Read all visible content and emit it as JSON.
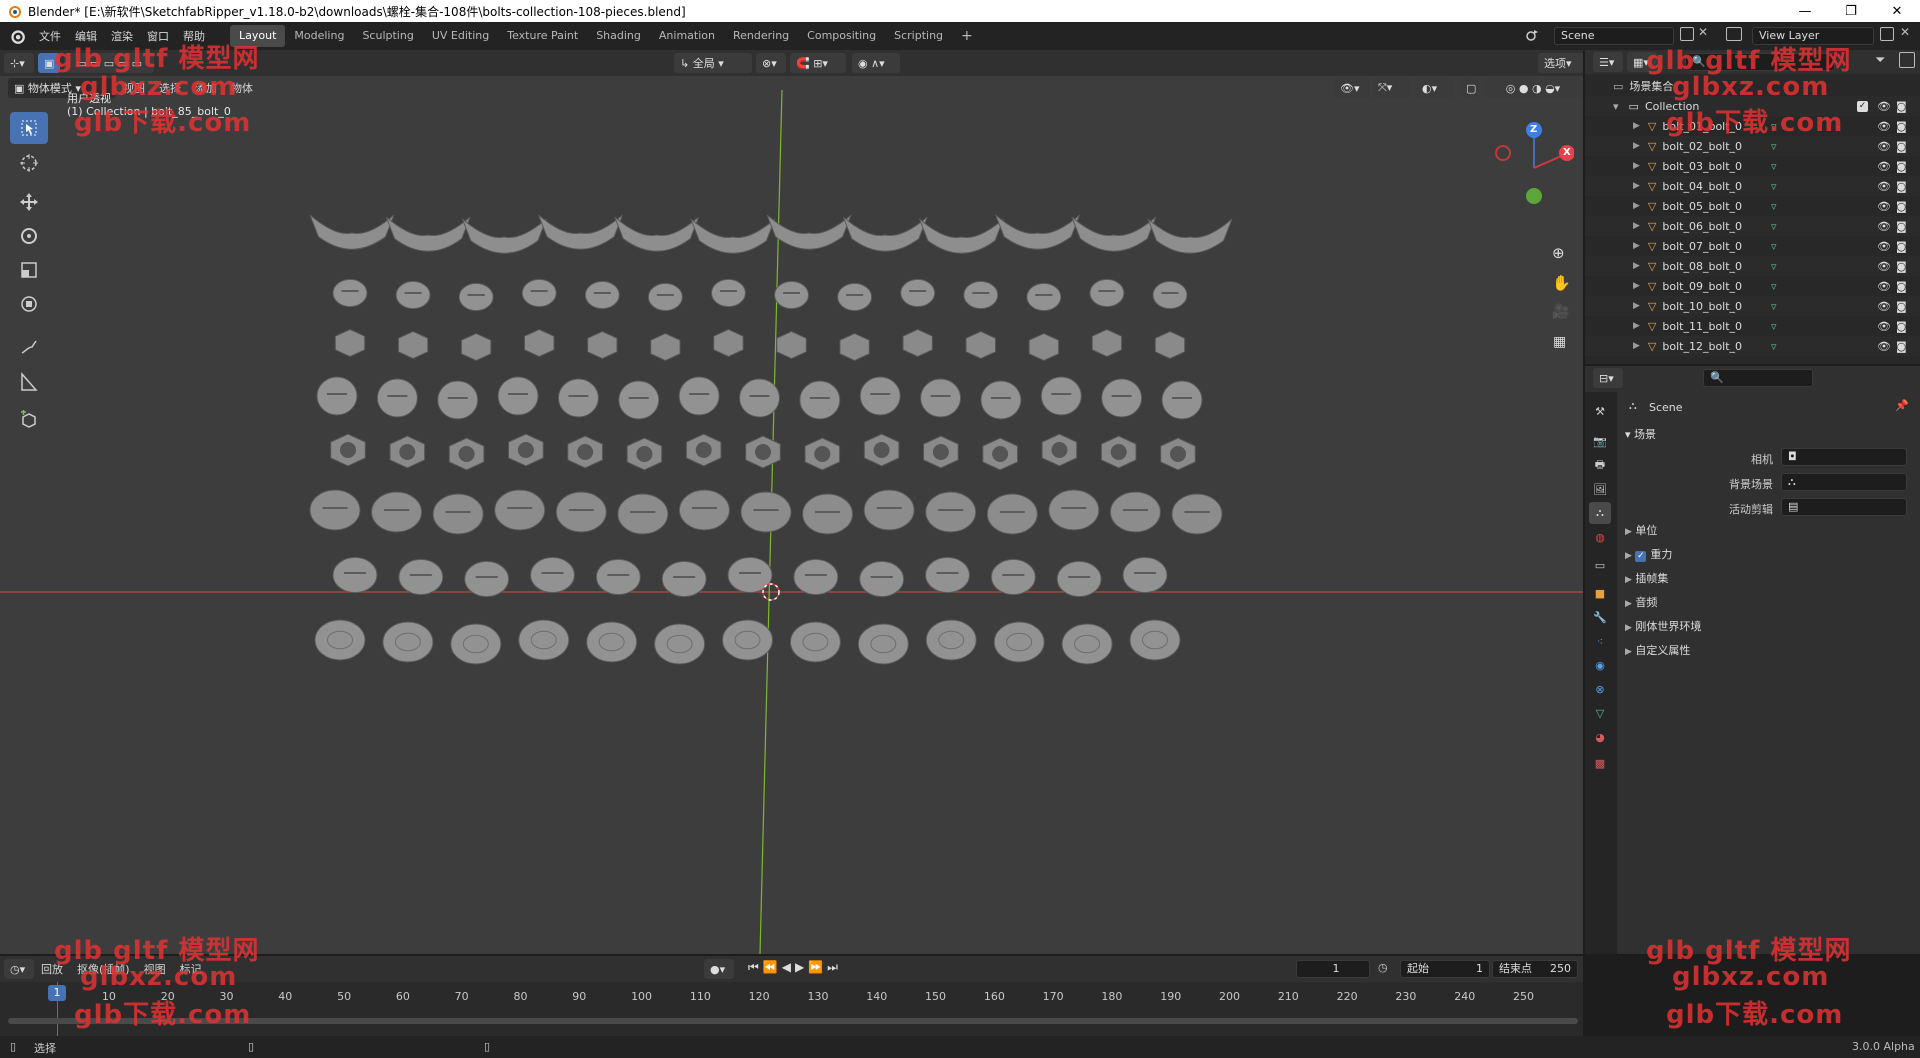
{
  "window": {
    "title": "Blender* [E:\\新软件\\SketchfabRipper_v1.18.0-b2\\downloads\\螺栓-集合-108件\\bolts-collection-108-pieces.blend]",
    "minimize": "—",
    "maximize": "❐",
    "close": "✕"
  },
  "menu": [
    "文件",
    "编辑",
    "渲染",
    "窗口",
    "帮助"
  ],
  "workspaces": [
    "Layout",
    "Modeling",
    "Sculpting",
    "UV Editing",
    "Texture Paint",
    "Shading",
    "Animation",
    "Rendering",
    "Compositing",
    "Scripting"
  ],
  "workspace_add": "+",
  "scene_field": "Scene",
  "view_layer_field": "View Layer",
  "viewport": {
    "mode": "物体模式",
    "menus": [
      "视图",
      "选择",
      "添加",
      "物体"
    ],
    "transform_orientation": "全局",
    "options": "选项",
    "overlay_title": "用户透视",
    "overlay_sub": "(1) Collection | bolt_85_bolt_0",
    "gizmo": {
      "z": "Z",
      "x": "X"
    }
  },
  "outliner": {
    "root": "场景集合",
    "collection": "Collection",
    "items": [
      "bolt_01_bolt_0",
      "bolt_02_bolt_0",
      "bolt_03_bolt_0",
      "bolt_04_bolt_0",
      "bolt_05_bolt_0",
      "bolt_06_bolt_0",
      "bolt_07_bolt_0",
      "bolt_08_bolt_0",
      "bolt_09_bolt_0",
      "bolt_10_bolt_0",
      "bolt_11_bolt_0",
      "bolt_12_bolt_0"
    ]
  },
  "properties": {
    "header": "Scene",
    "section": "场景",
    "camera_label": "相机",
    "background_label": "背景场景",
    "clip_label": "活动剪辑",
    "panels": [
      "单位",
      "重力",
      "插帧集",
      "音频",
      "刚体世界环境",
      "自定义属性"
    ],
    "gravity_checked": true
  },
  "timeline": {
    "menus": [
      "回放",
      "抠像(插帧)",
      "视图",
      "标记"
    ],
    "current_frame": "1",
    "start_label": "起始",
    "start_value": "1",
    "end_label": "结束点",
    "end_value": "250",
    "ticks": [
      "1",
      "10",
      "20",
      "30",
      "40",
      "50",
      "60",
      "70",
      "80",
      "90",
      "100",
      "110",
      "120",
      "130",
      "140",
      "150",
      "160",
      "170",
      "180",
      "190",
      "200",
      "210",
      "220",
      "230",
      "240",
      "250"
    ]
  },
  "status": {
    "left": "选择",
    "version": "3.0.0 Alpha"
  },
  "watermarks": [
    "glb gltf 模型网",
    "glbxz.com",
    "glb下载.com"
  ],
  "colors": {
    "accent": "#4772b3",
    "bg_viewport": "#3d3d3d",
    "axis_x": "#b34848",
    "axis_y": "#7db82e",
    "watermark": "#e23232"
  }
}
